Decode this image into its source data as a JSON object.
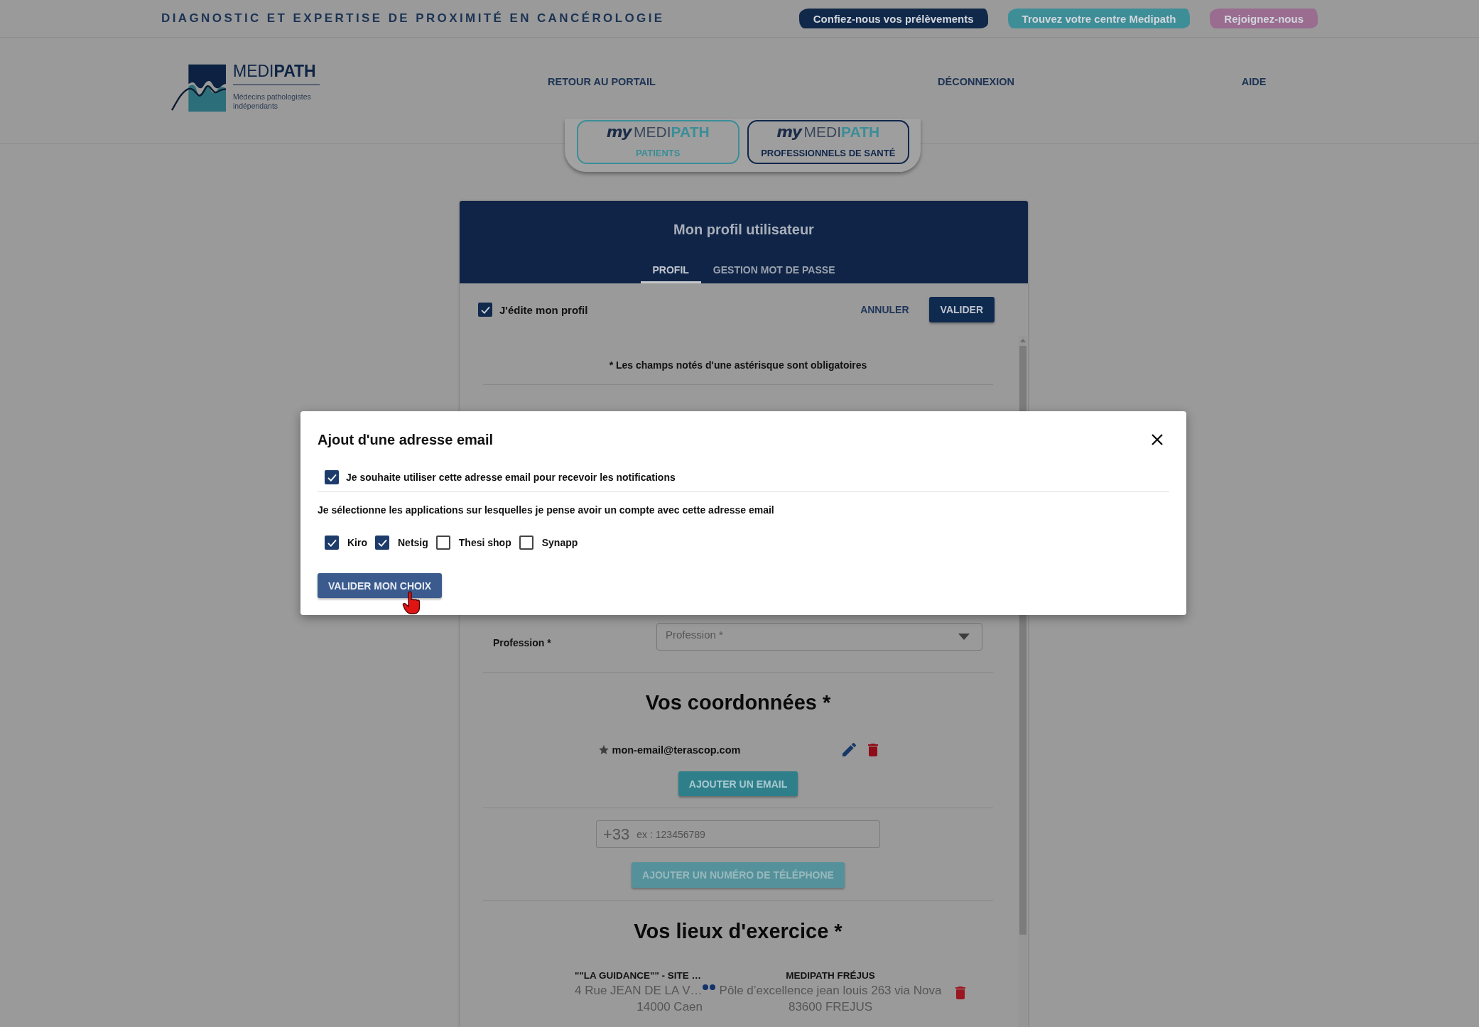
{
  "top_bar": {
    "tagline": "DIAGNOSTIC ET EXPERTISE DE PROXIMITÉ EN CANCÉROLOGIE",
    "links": [
      {
        "label": "Confiez-nous vos prélèvements",
        "color": "#10284a"
      },
      {
        "label": "Trouvez votre centre Medipath",
        "color": "#3e8e97"
      },
      {
        "label": "Rejoignez-nous",
        "color": "#996c90"
      }
    ]
  },
  "header": {
    "logo": {
      "name": "MEDI**PATH**",
      "subtitle": "Médecins pathologistes indépendants"
    },
    "nav": [
      "RETOUR AU PORTAIL",
      "DÉCONNEXION",
      "AIDE"
    ],
    "spaces": [
      {
        "prefix": "my",
        "name": "MEDI**PATH**",
        "label": "PATIENTS",
        "color": "#3a8e98"
      },
      {
        "prefix": "my",
        "name": "MEDI**PATH**",
        "label": "PROFESSIONNELS DE SANTÉ",
        "color": "#10264a"
      }
    ]
  },
  "profile_card": {
    "title": "Mon profil utilisateur",
    "tabs": [
      {
        "label": "PROFIL",
        "selected": true
      },
      {
        "label": "GESTION MOT DE PASSE",
        "selected": false
      }
    ],
    "edit_toggle": {
      "label": "J'édite mon profil",
      "checked": true
    },
    "actions": [
      {
        "label": "ANNULER",
        "kind": "text"
      },
      {
        "label": "VALIDER",
        "kind": "filled"
      }
    ],
    "required_note": "* Les champs notés d'une astérisque sont obligatoires",
    "profession": {
      "label": "Profession *",
      "placeholder": "Profession *"
    },
    "contact": {
      "heading": "Vos coordonnées *",
      "emails": [
        {
          "address": "mon-email@terascop.com",
          "primary": true
        }
      ],
      "add_email": {
        "label": "AJOUTER UN EMAIL",
        "disabled": false
      },
      "phone": {
        "prefix": "+33",
        "placeholder": "ex : 123456789"
      },
      "add_phone": {
        "label": "AJOUTER UN NUMÉRO DE TÉLÉPHONE",
        "disabled": true
      }
    },
    "workplaces": {
      "heading": "Vos lieux d'exercice *",
      "items": [
        {
          "name": "\"\"LA GUIDANCE\"\" - SITE …",
          "address": "4 Rue JEAN DE LA V…",
          "city": "14000 Caen"
        },
        {
          "name": "MEDIPATH FRÉJUS",
          "address": "Pôle d’excellence jean louis 263 via Nova",
          "city": "83600 FREJUS"
        }
      ]
    }
  },
  "dialog": {
    "title": "Ajout d'une adresse email",
    "notify_option": {
      "label": "Je souhaite utiliser cette adresse email pour recevoir les notifications",
      "checked": true
    },
    "apps_prompt": "Je sélectionne les applications sur lesquelles je pense avoir un compte avec cette adresse email",
    "apps": [
      {
        "label": "Kiro",
        "checked": true
      },
      {
        "label": "Netsig",
        "checked": true
      },
      {
        "label": "Thesi shop",
        "checked": false
      },
      {
        "label": "Synapp",
        "checked": false
      }
    ],
    "submit": "VALIDER MON CHOIX"
  }
}
